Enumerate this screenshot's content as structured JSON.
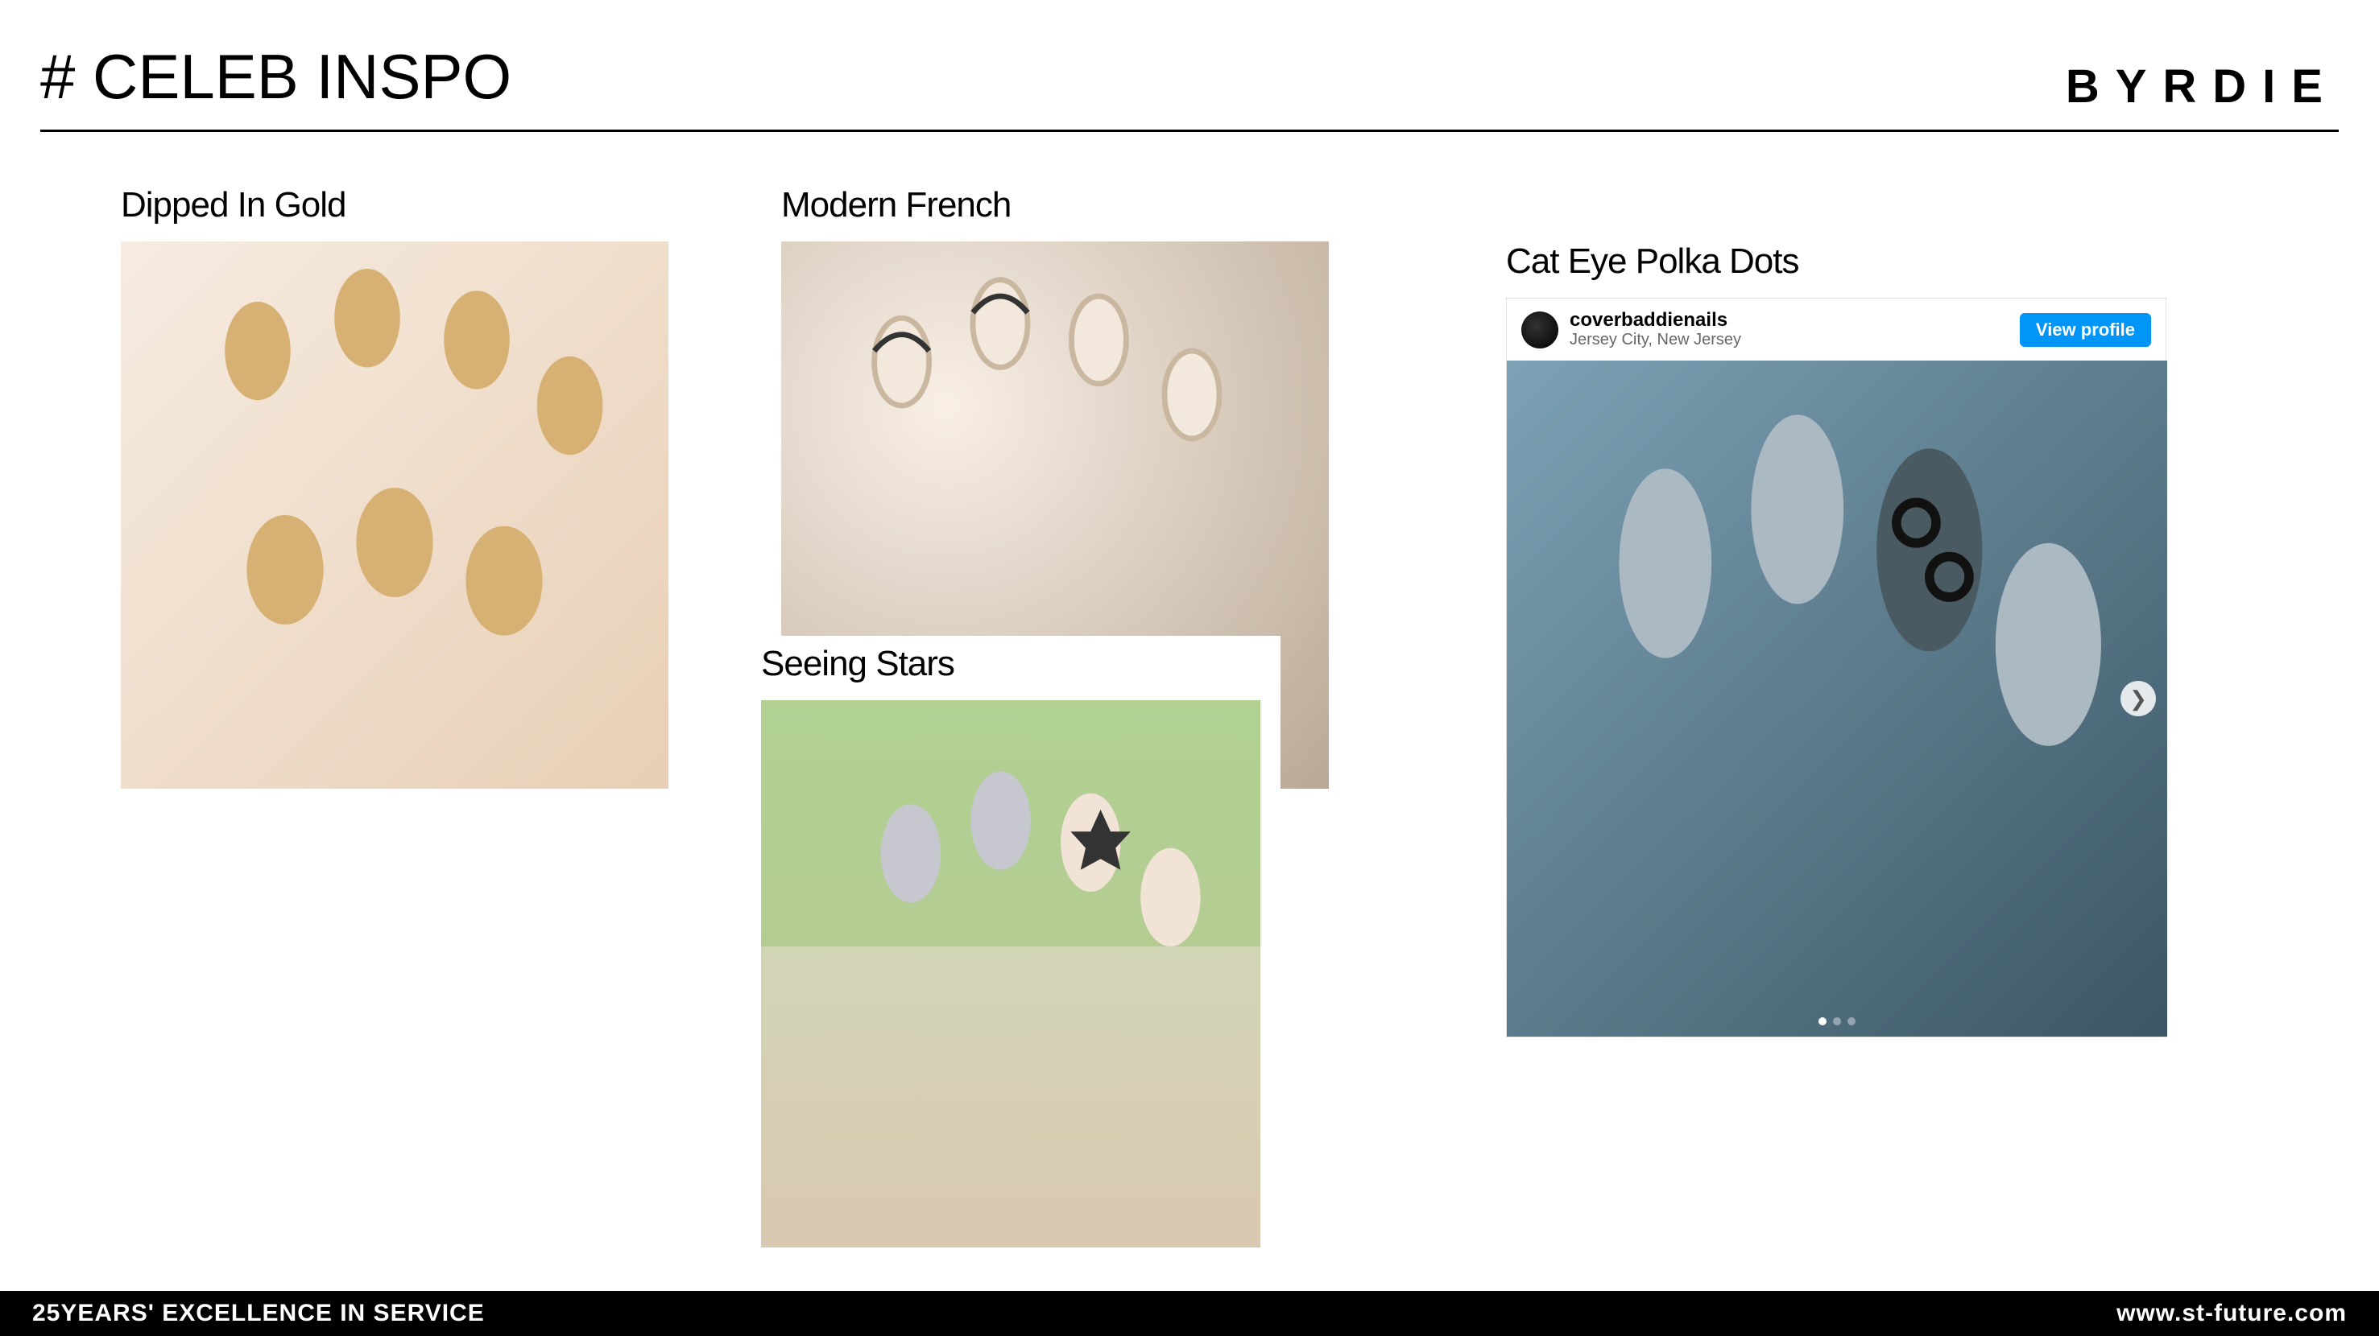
{
  "header": {
    "title": "# CELEB INSPO",
    "brand": "BYRDIE"
  },
  "cards": {
    "dipped": {
      "title": "Dipped In Gold"
    },
    "modern": {
      "title": "Modern French"
    },
    "stars": {
      "title": "Seeing Stars"
    },
    "cateye": {
      "title": "Cat Eye Polka Dots"
    }
  },
  "instagram": {
    "username": "coverbaddienails",
    "location": "Jersey City, New Jersey",
    "view_profile": "View profile"
  },
  "footer": {
    "tagline": "25YEARS' EXCELLENCE IN SERVICE",
    "site": "www.st-future.com"
  }
}
